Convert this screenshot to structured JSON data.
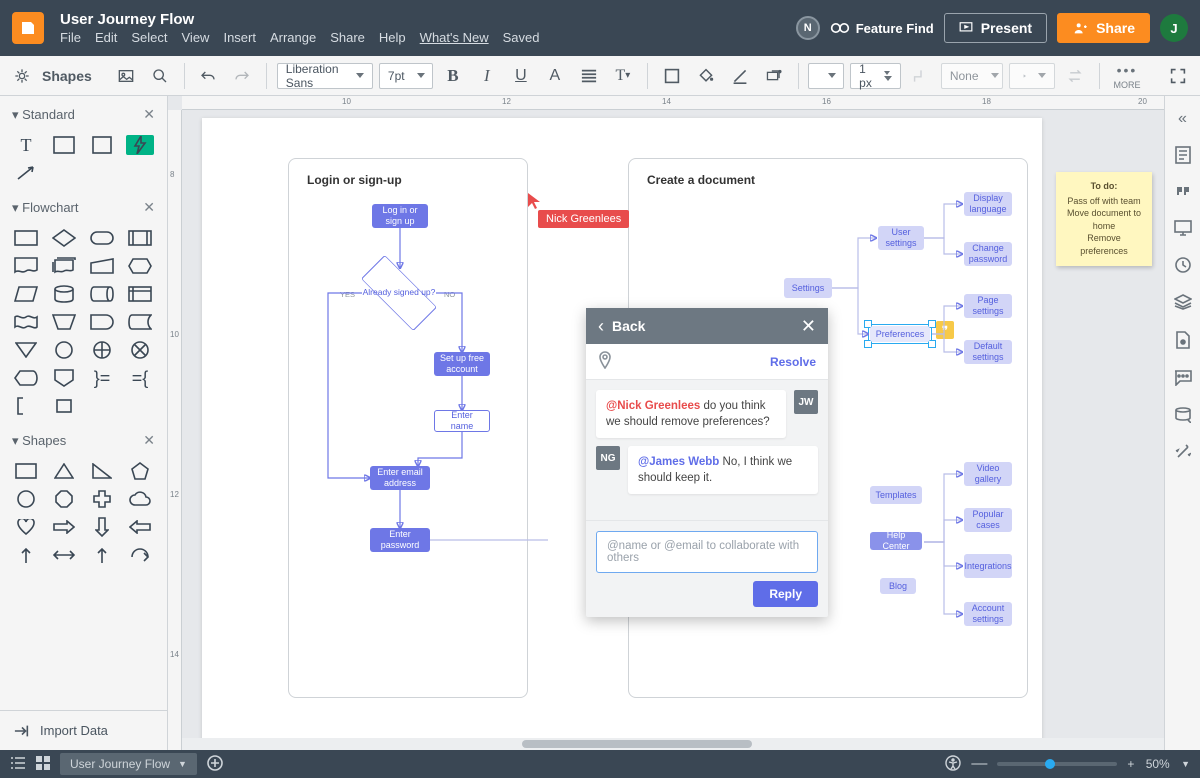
{
  "header": {
    "title": "User Journey Flow",
    "menus": [
      "File",
      "Edit",
      "Select",
      "View",
      "Insert",
      "Arrange",
      "Share",
      "Help",
      "What's New",
      "Saved"
    ],
    "n_badge": "N",
    "feature_find": "Feature Find",
    "present": "Present",
    "share": "Share",
    "avatar": "J"
  },
  "toolbar": {
    "shapes_label": "Shapes",
    "font": "Liberation Sans",
    "font_size": "7pt",
    "stroke_width": "1 px",
    "line_style_none": "None",
    "more": "MORE"
  },
  "left": {
    "standard": "Standard",
    "flowchart": "Flowchart",
    "shapes": "Shapes",
    "import": "Import Data"
  },
  "ruler_h": {
    "t10": "10",
    "t12": "12",
    "t14": "14",
    "t16": "16",
    "t18": "18",
    "t20": "20"
  },
  "ruler_v": {
    "t8": "8",
    "t10": "10",
    "t12": "12",
    "t14": "14"
  },
  "canvas": {
    "card1_title": "Login or sign-up",
    "card2_title": "Create a document",
    "login_signup": "Log in or sign up",
    "already": "Already signed up?",
    "yes": "YES",
    "no": "NO",
    "setup": "Set up free account",
    "enter_name": "Enter name",
    "enter_email": "Enter email address",
    "enter_pwd": "Enter password",
    "n_settings": "Settings",
    "n_user_settings": "User settings",
    "n_prefs": "Preferences",
    "n_templates": "Templates",
    "n_help": "Help Center",
    "n_blog": "Blog",
    "n_disp_lang": "Display language",
    "n_change_pwd": "Change password",
    "n_page_set": "Page settings",
    "n_def_set": "Default settings",
    "n_vid": "Video gallery",
    "n_pop": "Popular cases",
    "n_integ": "Integrations",
    "n_acct": "Account settings"
  },
  "sticky": {
    "title": "To do:",
    "l1": "Pass off with team",
    "l2": "Move document to home",
    "l3": "Remove preferences"
  },
  "cursor": {
    "name": "Nick Greenlees"
  },
  "comments": {
    "back": "Back",
    "resolve": "Resolve",
    "jw": "JW",
    "ng": "NG",
    "m1_at": "@Nick Greenlees",
    "m1_txt": " do you think we should remove preferences?",
    "m2_at": "@James Webb",
    "m2_txt": " No, I think we should keep it.",
    "placeholder": "@name or @email to collaborate with others",
    "reply": "Reply"
  },
  "status": {
    "page": "User Journey Flow",
    "zoom": "50%",
    "plus": "+"
  }
}
